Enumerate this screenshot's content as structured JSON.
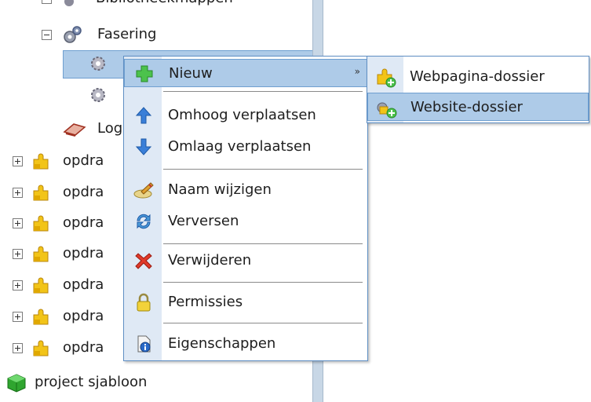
{
  "tree": {
    "top_partial_label": "Bibliotheekmappen",
    "fasering_label": "Fasering",
    "log_label": "Log",
    "opdracht_label": "opdra",
    "project_label": "project sjabloon"
  },
  "context_menu": {
    "items": [
      {
        "label": "Nieuw",
        "icon": "green-plus-icon"
      },
      {
        "label": "Omhoog verplaatsen",
        "icon": "arrow-up-icon"
      },
      {
        "label": "Omlaag verplaatsen",
        "icon": "arrow-down-icon"
      },
      {
        "label": "Naam wijzigen",
        "icon": "rename-icon"
      },
      {
        "label": "Verversen",
        "icon": "refresh-icon"
      },
      {
        "label": "Verwijderen",
        "icon": "delete-icon"
      },
      {
        "label": "Permissies",
        "icon": "lock-icon"
      },
      {
        "label": "Eigenschappen",
        "icon": "properties-icon"
      }
    ],
    "submenu_arrow": "»"
  },
  "submenu": {
    "items": [
      {
        "label": "Webpagina-dossier",
        "icon": "webpage-dossier-icon"
      },
      {
        "label": "Website-dossier",
        "icon": "website-dossier-icon"
      }
    ]
  },
  "colors": {
    "selection": "#aecbe8",
    "menu_border": "#5f8fc4",
    "gutter": "#dfe9f5"
  }
}
